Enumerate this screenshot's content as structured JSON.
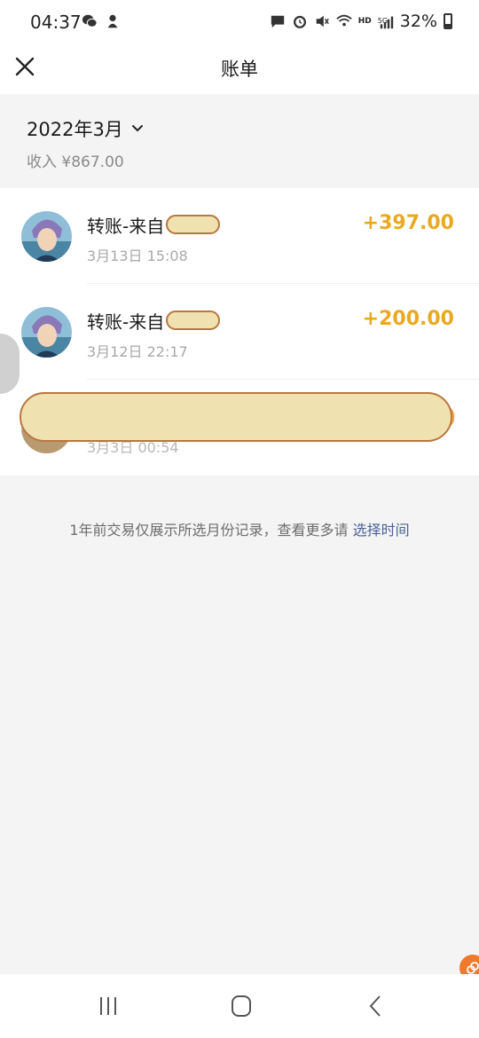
{
  "status_bar": {
    "time": "04:37",
    "battery": "32%",
    "hd": "HD",
    "network": "5G",
    "icons": [
      "wechat-icon",
      "app-icon",
      "message-icon",
      "alarm-icon",
      "mute-icon",
      "wifi-icon",
      "signal-icon",
      "battery-icon"
    ]
  },
  "header": {
    "title": "账单",
    "close_icon": "close-icon"
  },
  "month_section": {
    "month": "2022年3月",
    "income": "收入 ¥867.00"
  },
  "transactions": [
    {
      "title": "转账-来自",
      "time": "3月13日 15:08",
      "amount": "+397.00"
    },
    {
      "title": "转账-来自",
      "time": "3月12日 22:17",
      "amount": "+200.00"
    },
    {
      "title": "",
      "time": "3月3日 00:54",
      "amount": ""
    }
  ],
  "footer": {
    "note": "1年前交易仅展示所选月份记录，查看更多请",
    "link": "选择时间"
  },
  "colors": {
    "amount": "#e9a922",
    "link": "#4a6394",
    "background": "#f4f4f5"
  },
  "nav": {
    "recent_icon": "recent-apps-icon",
    "home_icon": "home-icon",
    "back_icon": "back-icon"
  }
}
